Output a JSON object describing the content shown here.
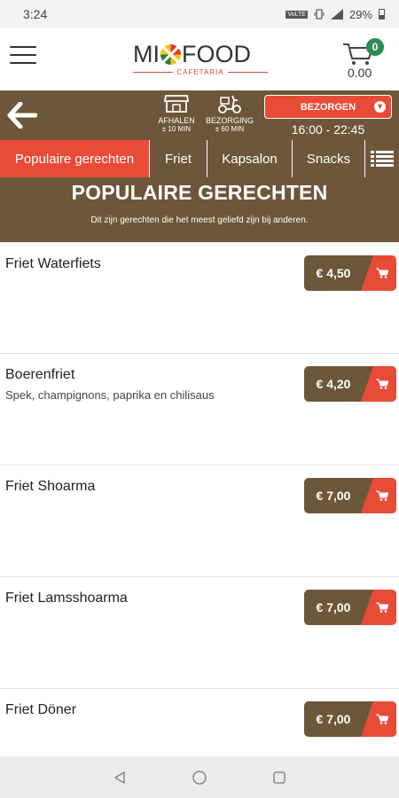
{
  "status": {
    "time": "3:24",
    "network": "VoLTE",
    "battery": "29%"
  },
  "brand": {
    "name_part1": "MI",
    "name_part2": "FOOD",
    "subtitle": "CAFETARIA"
  },
  "cart": {
    "count": "0",
    "total": "0.00"
  },
  "service": {
    "pickup_label": "AFHALEN",
    "pickup_time": "± 10 MIN",
    "delivery_label": "BEZORGING",
    "delivery_time": "± 60 MIN",
    "mode": "BEZORGEN",
    "hours": "16:00 - 22:45"
  },
  "tabs": [
    {
      "label": "Populaire gerechten",
      "active": true
    },
    {
      "label": "Friet",
      "active": false
    },
    {
      "label": "Kapsalon",
      "active": false
    },
    {
      "label": "Snacks",
      "active": false
    }
  ],
  "banner": {
    "title": "POPULAIRE GERECHTEN",
    "subtitle": "Dit zijn gerechten die het meest geliefd zijn bij anderen."
  },
  "items": [
    {
      "name": "Friet Waterfiets",
      "desc": "",
      "price": "€ 4,50"
    },
    {
      "name": "Boerenfriet",
      "desc": "Spek, champignons, paprika en chilisaus",
      "price": "€ 4,20"
    },
    {
      "name": "Friet Shoarma",
      "desc": "",
      "price": "€ 7,00"
    },
    {
      "name": "Friet Lamsshoarma",
      "desc": "",
      "price": "€ 7,00"
    },
    {
      "name": "Friet Döner",
      "desc": "",
      "price": "€ 7,00"
    }
  ],
  "colors": {
    "brown": "#6d5639",
    "accent": "#e84c38",
    "badge": "#2e8b57"
  },
  "icons": [
    "menu-icon",
    "cart-icon",
    "back-arrow-icon",
    "shop-icon",
    "scooter-icon",
    "chevron-down-icon",
    "list-icon",
    "back-nav-icon",
    "home-nav-icon",
    "recents-nav-icon"
  ]
}
